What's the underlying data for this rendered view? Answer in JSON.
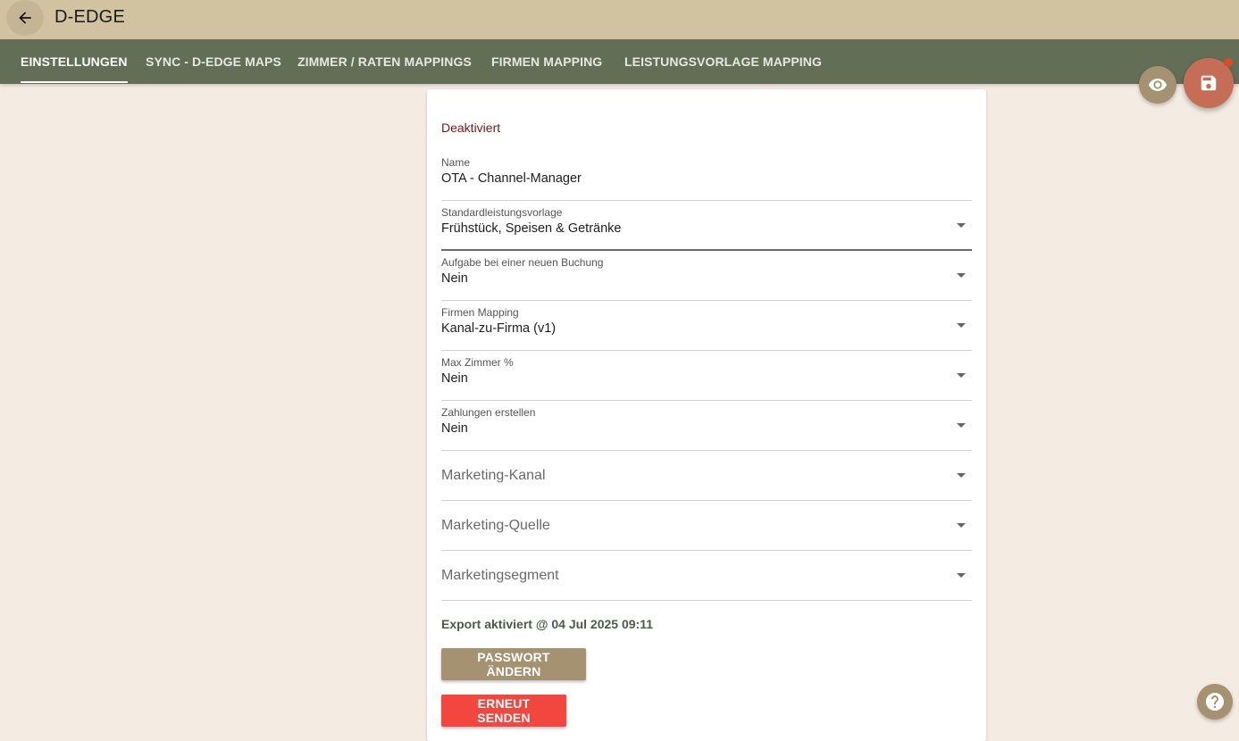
{
  "header": {
    "title": "D-EDGE",
    "back_icon": "arrow-left-icon"
  },
  "tabs": [
    {
      "label": "EINSTELLUNGEN",
      "active": true
    },
    {
      "label": "SYNC - D-EDGE MAPS",
      "active": false
    },
    {
      "label": "ZIMMER / RATEN MAPPINGS",
      "active": false
    },
    {
      "label": "FIRMEN MAPPING",
      "active": false
    },
    {
      "label": "LEISTUNGSVORLAGE MAPPING",
      "active": false
    }
  ],
  "status": {
    "text": "Deaktiviert",
    "color": "#7a1414"
  },
  "form": {
    "name": {
      "label": "Name",
      "value": "OTA - Channel-Manager"
    },
    "service_template": {
      "label": "Standardleistungsvorlage",
      "value": "Frühstück, Speisen & Getränke"
    },
    "task_new_booking": {
      "label": "Aufgabe bei einer neuen Buchung",
      "value": "Nein"
    },
    "company_mapping": {
      "label": "Firmen Mapping",
      "value": "Kanal-zu-Firma (v1)"
    },
    "max_rooms": {
      "label": "Max Zimmer %",
      "value": "Nein"
    },
    "create_payments": {
      "label": "Zahlungen erstellen",
      "value": "Nein"
    },
    "marketing_channel": {
      "placeholder": "Marketing-Kanal"
    },
    "marketing_source": {
      "placeholder": "Marketing-Quelle"
    },
    "marketing_segment": {
      "placeholder": "Marketingsegment"
    }
  },
  "export": {
    "text": "Export aktiviert @ 04 Jul 2025 09:11"
  },
  "buttons": {
    "change_password": "PASSWORT ÄNDERN",
    "resend": "ERNEUT SENDEN"
  },
  "colors": {
    "topbar": "#d2c3a0",
    "tabbar": "#636e57",
    "background": "#f4ece3",
    "accent_tan": "#a59270",
    "save_fab": "#c66e55",
    "danger": "#f2463e"
  }
}
